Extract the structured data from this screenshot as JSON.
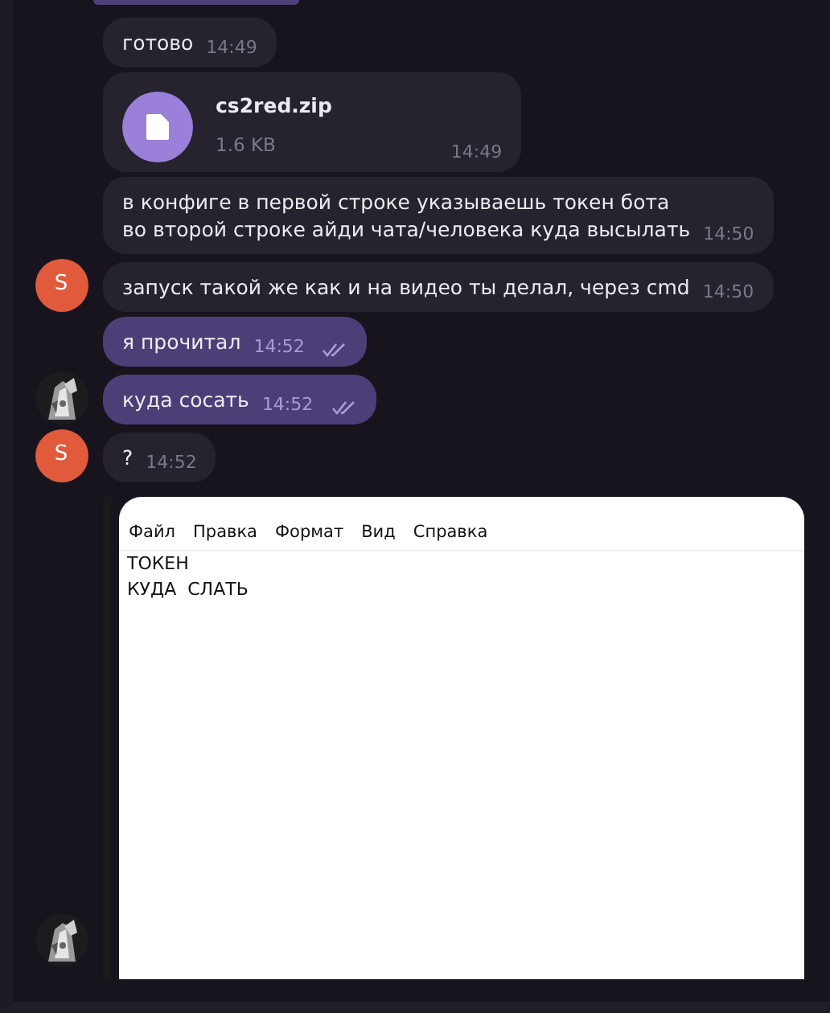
{
  "messages": [
    {
      "kind": "text",
      "text": "готово",
      "time": "14:49",
      "outgoing": false
    },
    {
      "kind": "file",
      "file_name": "cs2red.zip",
      "size": "1.6 KB",
      "time": "14:49",
      "outgoing": false
    },
    {
      "kind": "text",
      "text": "в конфиге в первой строке указываешь токен бота\nво второй строке айди чата/человека куда высылать",
      "time": "14:50",
      "outgoing": false
    },
    {
      "kind": "text",
      "text": "запуск такой же как и на видео ты делал, через cmd",
      "time": "14:50",
      "outgoing": false,
      "avatar": {
        "kind": "letter",
        "letter": "S"
      }
    },
    {
      "kind": "text",
      "text": "я прочитал",
      "time": "14:52",
      "outgoing": true,
      "read": true
    },
    {
      "kind": "text",
      "text": "куда сосать",
      "time": "14:52",
      "outgoing": true,
      "read": true
    },
    {
      "kind": "text",
      "text": "?",
      "time": "14:52",
      "outgoing": false,
      "avatar": {
        "kind": "letter",
        "letter": "S"
      }
    },
    {
      "kind": "screenshot",
      "menu": [
        "Файл",
        "Правка",
        "Формат",
        "Вид",
        "Справка"
      ],
      "lines": [
        "ТОКЕН",
        "КУДА  СЛАТЬ"
      ]
    }
  ]
}
